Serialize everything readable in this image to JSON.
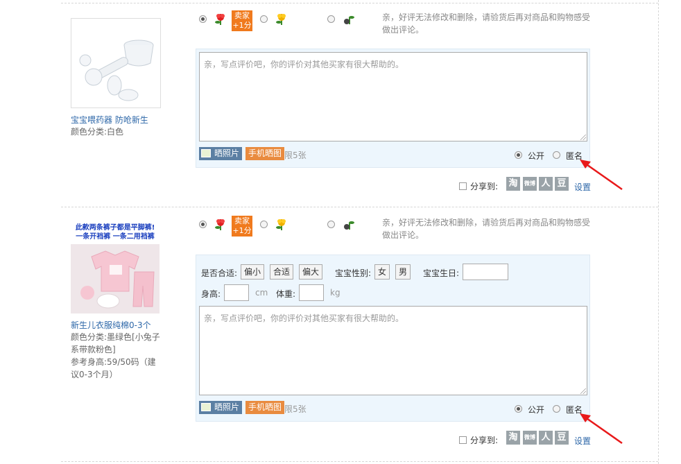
{
  "rating": {
    "seller_badge_line1": "卖家",
    "seller_badge_line2": "+1分",
    "hint": "亲，好评无法修改和删除，请验货后再对商品和购物感受做出评论。"
  },
  "review_placeholder": "亲，写点评价吧，你的评价对其他买家有很大帮助的。",
  "toolbar": {
    "photo_label": "晒照片",
    "mobile_label": "手机晒图",
    "limit_label": "限5张",
    "public_label": "公开",
    "anonymous_label": "匿名"
  },
  "share": {
    "label": "分享到:",
    "icons": [
      "淘",
      "微博",
      "人",
      "豆"
    ],
    "settings_label": "设置"
  },
  "items": [
    {
      "name": "宝宝喂药器 防呛新生",
      "attrs": [
        "颜色分类:白色"
      ]
    },
    {
      "name": "新生儿衣服纯棉0-3个",
      "attrs": [
        "颜色分类:墨绿色[小兔子系带款粉色]",
        "参考身高:59/50码（建议0-3个月）"
      ],
      "image_caption_line1": "此款两条裤子都是平脚裤!",
      "image_caption_line2": "一条开裆裤  一条二用裆裤",
      "fit": {
        "label": "是否合适:",
        "options": [
          "偏小",
          "合适",
          "偏大"
        ],
        "gender_label": "宝宝性别:",
        "gender_options": [
          "女",
          "男"
        ],
        "birthday_label": "宝宝生日:",
        "height_label": "身高:",
        "height_unit": "cm",
        "weight_label": "体重:",
        "weight_unit": "kg"
      }
    }
  ],
  "colors": {
    "accent_link": "#2d67a8",
    "seller_badge": "#f07a1d",
    "arrow": "#e8191a"
  }
}
